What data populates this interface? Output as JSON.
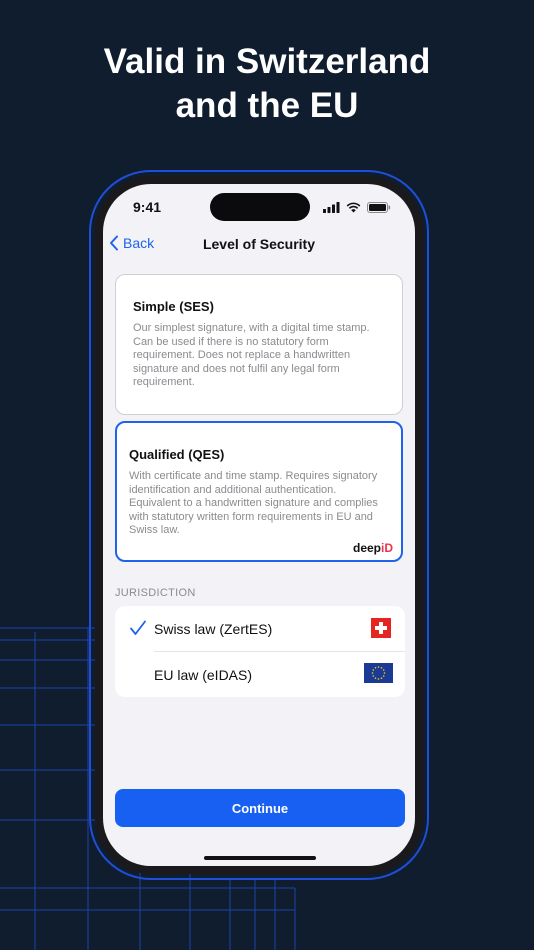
{
  "headline": {
    "line1": "Valid in Switzerland",
    "line2": "and the EU"
  },
  "status_bar": {
    "time": "9:41",
    "icons": [
      "signal-icon",
      "wifi-icon",
      "battery-icon"
    ]
  },
  "nav": {
    "back_label": "Back",
    "title": "Level of Security"
  },
  "options": [
    {
      "title": "Simple (SES)",
      "description": "Our simplest signature, with a digital time stamp. Can be used if there is no statutory form requirement. Does not replace a handwritten signature and does not fulfil any legal form requirement."
    },
    {
      "title": "Qualified (QES)",
      "description": "With certificate and time stamp. Requires signatory identification and additional authentication. Equivalent to a handwritten signature and complies with statutory written form requirements in EU and Swiss law.",
      "brand": {
        "main": "deep",
        "accent": "iD"
      }
    }
  ],
  "jurisdiction": {
    "label": "JURISDICTION",
    "items": [
      {
        "label": "Swiss law (ZertES)",
        "selected": true,
        "flag": "swiss-flag-icon"
      },
      {
        "label": "EU law (eIDAS)",
        "selected": false,
        "flag": "eu-flag-icon"
      }
    ]
  },
  "continue_label": "Continue",
  "colors": {
    "background": "#0f1d2e",
    "accent": "#1e63e9",
    "button": "#1760f2",
    "swiss_red": "#e52521",
    "eu_blue": "#1a3a96",
    "eu_gold": "#f5d000",
    "brand_red": "#e8344a"
  }
}
